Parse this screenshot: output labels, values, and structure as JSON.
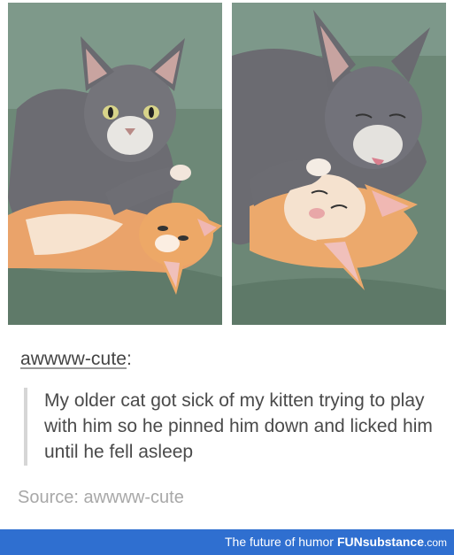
{
  "post": {
    "username": "awwww-cute",
    "colon": ":",
    "quote": "My older cat got sick of my kitten trying to play with him so he pinned him down and licked him until he fell asleep",
    "source": "Source: awwww-cute"
  },
  "footer": {
    "tagline": "The future of humor",
    "brand_prefix": "FUN",
    "brand_suffix": "substance",
    "domain": ".com"
  },
  "colors": {
    "footer_bg": "#2f6fd0",
    "couch": "#6f8a78",
    "gray_cat": "#6e6e74",
    "orange_kitten": "#e9a56b"
  }
}
